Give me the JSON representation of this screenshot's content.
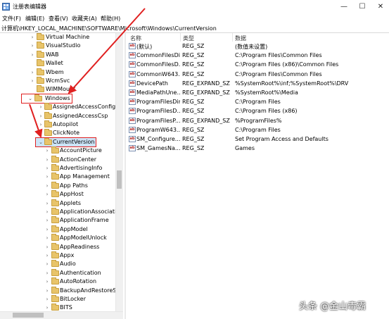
{
  "window": {
    "title": "注册表编辑器",
    "minimize": "—",
    "maximize": "☐",
    "close": "✕"
  },
  "menu": [
    "文件(F)",
    "编辑(E)",
    "查看(V)",
    "收藏夹(A)",
    "帮助(H)"
  ],
  "address": "计算机\\HKEY_LOCAL_MACHINE\\SOFTWARE\\Microsoft\\Windows\\CurrentVersion",
  "tree": {
    "items": [
      {
        "label": "Virtual Machine",
        "expander": "›"
      },
      {
        "label": "VisualStudio",
        "expander": "›"
      },
      {
        "label": "WAB",
        "expander": "›"
      },
      {
        "label": "Wallet",
        "expander": ""
      },
      {
        "label": "Wbem",
        "expander": "›"
      },
      {
        "label": "WcmSvc",
        "expander": "›"
      },
      {
        "label": "WIMMount",
        "expander": ""
      },
      {
        "label": "Windows",
        "expander": "⌄"
      },
      {
        "label": "AssignedAccessConfigura",
        "expander": "›"
      },
      {
        "label": "AssignedAccessCsp",
        "expander": "›"
      },
      {
        "label": "Autopilot",
        "expander": "›"
      },
      {
        "label": "ClickNote",
        "expander": "›"
      },
      {
        "label": "CurrentVersion",
        "expander": "⌄"
      },
      {
        "label": "AccountPicture",
        "expander": "›"
      },
      {
        "label": "ActionCenter",
        "expander": "›"
      },
      {
        "label": "AdvertisingInfo",
        "expander": "›"
      },
      {
        "label": "App Management",
        "expander": "›"
      },
      {
        "label": "App Paths",
        "expander": "›"
      },
      {
        "label": "AppHost",
        "expander": "›"
      },
      {
        "label": "Applets",
        "expander": "›"
      },
      {
        "label": "ApplicationAssociatio",
        "expander": "›"
      },
      {
        "label": "ApplicationFrame",
        "expander": "›"
      },
      {
        "label": "AppModel",
        "expander": "›"
      },
      {
        "label": "AppModelUnlock",
        "expander": "›"
      },
      {
        "label": "AppReadiness",
        "expander": "›"
      },
      {
        "label": "Appx",
        "expander": "›"
      },
      {
        "label": "Audio",
        "expander": "›"
      },
      {
        "label": "Authentication",
        "expander": "›"
      },
      {
        "label": "AutoRotation",
        "expander": "›"
      },
      {
        "label": "BackupAndRestoreSet",
        "expander": "›"
      },
      {
        "label": "BitLocker",
        "expander": "›"
      },
      {
        "label": "BITS",
        "expander": "›"
      }
    ]
  },
  "values": {
    "headers": {
      "name": "名称",
      "type": "类型",
      "data": "数据"
    },
    "rows": [
      {
        "icon": "ab",
        "name": "(默认)",
        "type": "REG_SZ",
        "data": "(数值未设置)"
      },
      {
        "icon": "ab",
        "name": "CommonFilesDir",
        "type": "REG_SZ",
        "data": "C:\\Program Files\\Common Files"
      },
      {
        "icon": "ab",
        "name": "CommonFilesD...",
        "type": "REG_SZ",
        "data": "C:\\Program Files (x86)\\Common Files"
      },
      {
        "icon": "ab",
        "name": "CommonW643...",
        "type": "REG_SZ",
        "data": "C:\\Program Files\\Common Files"
      },
      {
        "icon": "ab",
        "name": "DevicePath",
        "type": "REG_EXPAND_SZ",
        "data": "%SystemRoot%\\inf;%SystemRoot%\\DRV"
      },
      {
        "icon": "ab",
        "name": "MediaPathUne...",
        "type": "REG_EXPAND_SZ",
        "data": "%SystemRoot%\\Media"
      },
      {
        "icon": "ab",
        "name": "ProgramFilesDir",
        "type": "REG_SZ",
        "data": "C:\\Program Files"
      },
      {
        "icon": "ab",
        "name": "ProgramFilesD...",
        "type": "REG_SZ",
        "data": "C:\\Program Files (x86)"
      },
      {
        "icon": "ab",
        "name": "ProgramFilesP...",
        "type": "REG_EXPAND_SZ",
        "data": "%ProgramFiles%"
      },
      {
        "icon": "ab",
        "name": "ProgramW643...",
        "type": "REG_SZ",
        "data": "C:\\Program Files"
      },
      {
        "icon": "ab",
        "name": "SM_Configure...",
        "type": "REG_SZ",
        "data": "Set Program Access and Defaults"
      },
      {
        "icon": "ab",
        "name": "SM_GamesNa...",
        "type": "REG_SZ",
        "data": "Games"
      }
    ]
  },
  "watermark": "头条 @金山毒霸",
  "colors": {
    "highlight": "#e02020",
    "selection": "#cce4f7",
    "folder": "#e8c46a"
  }
}
